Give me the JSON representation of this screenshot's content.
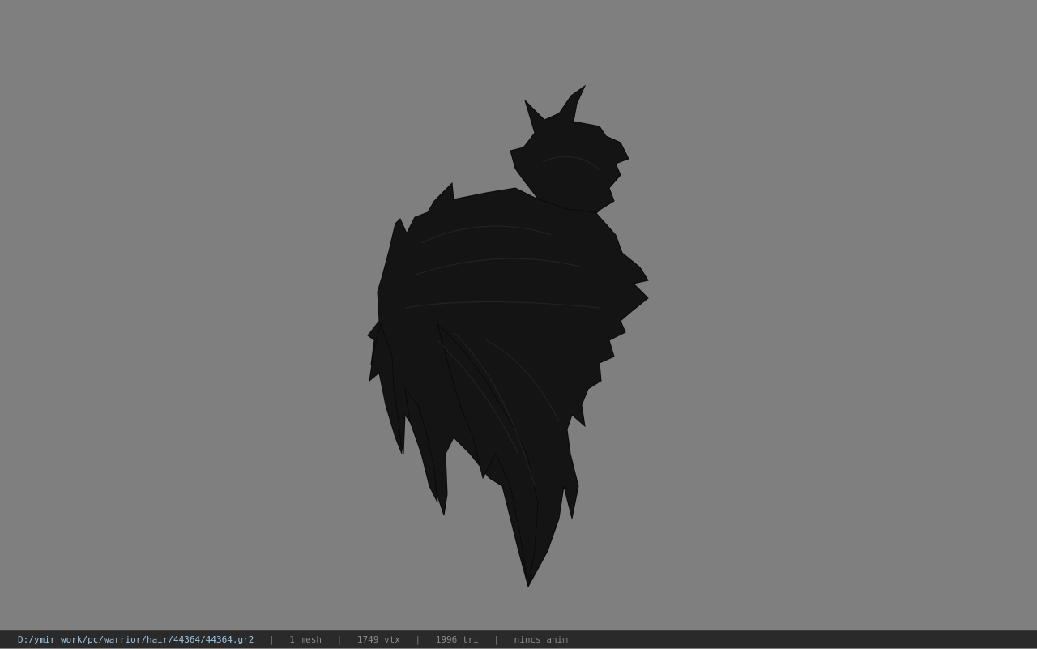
{
  "viewer": {
    "background_color": "#7f7f7f",
    "model_color": "#141414",
    "model_icon": "hair-mesh-model"
  },
  "status_bar": {
    "file_path": "D:/ymir work/pc/warrior/hair/44364/44364.gr2",
    "separator": "|",
    "mesh_count": "1 mesh",
    "vertex_count": "1749 vtx",
    "triangle_count": "1996 tri",
    "anim_info": "nincs anim",
    "path_color": "#9cc8e8",
    "text_color": "#8c8c8c"
  }
}
